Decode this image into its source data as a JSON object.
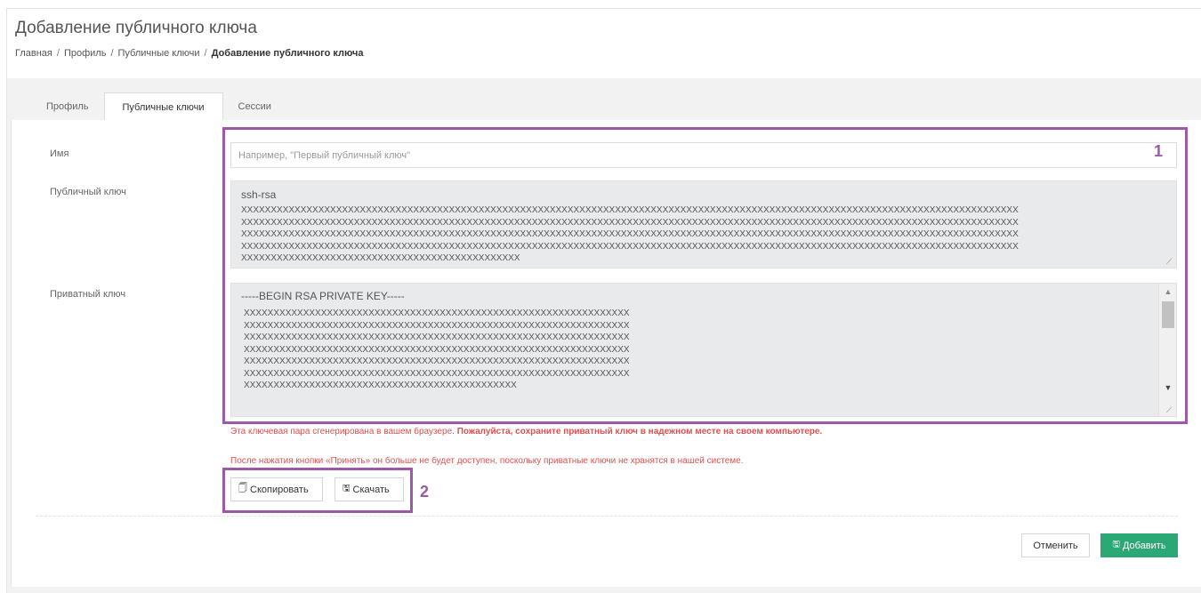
{
  "page": {
    "title": "Добавление публичного ключа"
  },
  "breadcrumb": {
    "items": [
      "Главная",
      "Профиль",
      "Публичные ключи"
    ],
    "current": "Добавление публичного ключа"
  },
  "tabs": [
    {
      "label": "Профиль",
      "active": false
    },
    {
      "label": "Публичные ключи",
      "active": true
    },
    {
      "label": "Сессии",
      "active": false
    }
  ],
  "form": {
    "name_label": "Имя",
    "name_placeholder": "Например, \"Первый публичный ключ\"",
    "name_value": "",
    "public_key_label": "Публичный ключ",
    "public_key_first_line": "ssh-rsa",
    "public_key_lines": [
      "XXXXXXXXXXXXXXXXXXXXXXXXXXXXXXXXXXXXXXXXXXXXXXXXXXXXXXXXXXXXXXXXXXXXXXXXXXXXXXXXXXXXXXXXXXXXXXXXXXXXXXXXXXXXXXXXXXXXXXXXXXXXXXXXXXX",
      "XXXXXXXXXXXXXXXXXXXXXXXXXXXXXXXXXXXXXXXXXXXXXXXXXXXXXXXXXXXXXXXXXXXXXXXXXXXXXXXXXXXXXXXXXXXXXXXXXXXXXXXXXXXXXXXXXXXXXXXXXXXXXXXXXXX",
      "XXXXXXXXXXXXXXXXXXXXXXXXXXXXXXXXXXXXXXXXXXXXXXXXXXXXXXXXXXXXXXXXXXXXXXXXXXXXXXXXXXXXXXXXXXXXXXXXXXXXXXXXXXXXXXXXXXXXXXXXXXXXXXXXXXX",
      "XXXXXXXXXXXXXXXXXXXXXXXXXXXXXXXXXXXXXXXXXXXXXXXXXXXXXXXXXXXXXXXXXXXXXXXXXXXXXXXXXXXXXXXXXXXXXXXXXXXXXXXXXXXXXXXXXXXXXXXXXXXXXXXXXXX",
      "XXXXXXXXXXXXXXXXXXXXXXXXXXXXXXXXXXXXXXXXXXXXXXX"
    ],
    "private_key_label": "Приватный ключ",
    "private_key_first_line": "-----BEGIN RSA PRIVATE KEY-----",
    "private_key_lines": [
      "XXXXXXXXXXXXXXXXXXXXXXXXXXXXXXXXXXXXXXXXXXXXXXXXXXXXXXXXXXXXXXXXX",
      "XXXXXXXXXXXXXXXXXXXXXXXXXXXXXXXXXXXXXXXXXXXXXXXXXXXXXXXXXXXXXXXXX",
      "XXXXXXXXXXXXXXXXXXXXXXXXXXXXXXXXXXXXXXXXXXXXXXXXXXXXXXXXXXXXXXXXX",
      "XXXXXXXXXXXXXXXXXXXXXXXXXXXXXXXXXXXXXXXXXXXXXXXXXXXXXXXXXXXXXXXXX",
      "XXXXXXXXXXXXXXXXXXXXXXXXXXXXXXXXXXXXXXXXXXXXXXXXXXXXXXXXXXXXXXXXX",
      "XXXXXXXXXXXXXXXXXXXXXXXXXXXXXXXXXXXXXXXXXXXXXXXXXXXXXXXXXXXXXXXXX",
      "XXXXXXXXXXXXXXXXXXXXXXXXXXXXXXXXXXXXXXXXXXXXXX"
    ]
  },
  "warning": {
    "line1_normal": "Эта ключевая пара сгенерирована в вашем браузере. ",
    "line1_bold": "Пожалуйста, сохраните приватный ключ в надежном месте на своем компьютере.",
    "line2": "После нажатия кнопки «Принять» он больше не будет доступен, поскольку приватные ключи не хранятся в нашей системе."
  },
  "buttons": {
    "copy": "Скопировать",
    "download": "Скачать",
    "cancel": "Отменить",
    "add": "Добавить"
  },
  "annotations": {
    "marker1": "1",
    "marker2": "2"
  },
  "icons": {
    "copy": "copy-icon",
    "download": "save-icon",
    "add": "save-icon",
    "scroll_up": "arrow-up-icon",
    "scroll_down": "arrow-down-icon",
    "resize": "resize-grip-icon"
  },
  "colors": {
    "accent_green": "#2aa876",
    "highlight_purple": "#9b59a8",
    "warning_red": "#e05050"
  }
}
